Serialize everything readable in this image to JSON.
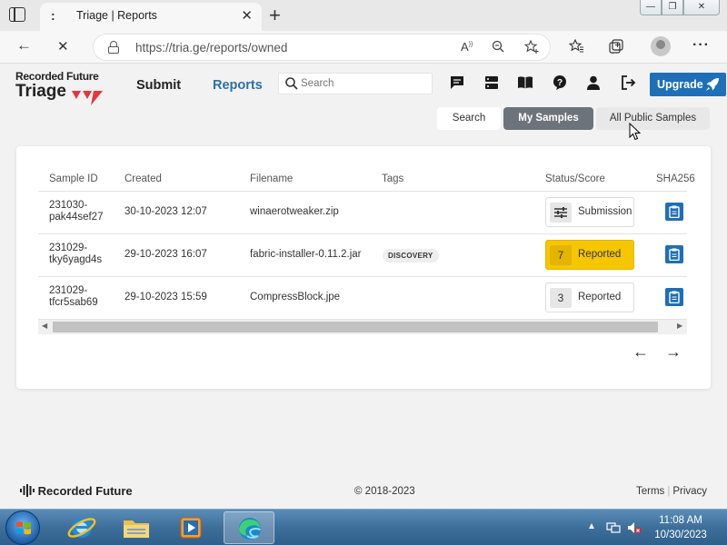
{
  "browser": {
    "tab_title": "Triage | Reports",
    "tab_dots": ":",
    "tab_close": "✕",
    "new_tab": "+",
    "url": "https://tria.ge/reports/owned",
    "window_min": "—",
    "window_max": "❐",
    "window_close": "✕",
    "back": "←",
    "reload_stop": "✕",
    "more": "···"
  },
  "site": {
    "brand_top": "Recorded Future",
    "brand_bottom": "Triage",
    "nav": {
      "submit": "Submit",
      "reports": "Reports"
    },
    "search": {
      "placeholder": "Search",
      "value": ""
    },
    "upgrade_label": "Upgrade",
    "segments": {
      "search": "Search",
      "my_samples": "My Samples",
      "public_samples": "All Public Samples"
    },
    "accent_color": "#1f6fb8",
    "highlight_color": "#f6c600"
  },
  "table": {
    "columns": [
      "Sample ID",
      "Created",
      "Filename",
      "Tags",
      "Status/Score",
      "SHA256"
    ],
    "rows": [
      {
        "id_line1": "231030-",
        "id_line2": "pak44sef27",
        "created": "30-10-2023 12:07",
        "filename": "winaerotweaker.zip",
        "tag": "",
        "score": "",
        "status": "Submission",
        "score_icon": "sliders-icon"
      },
      {
        "id_line1": "231029-",
        "id_line2": "tky6yagd4s",
        "created": "29-10-2023 16:07",
        "filename": "fabric-installer-0.11.2.jar",
        "tag": "DISCOVERY",
        "score": "7",
        "status": "Reported"
      },
      {
        "id_line1": "231029-",
        "id_line2": "tfcr5sab69",
        "created": "29-10-2023 15:59",
        "filename": "CompressBlock.jpe",
        "tag": "",
        "score": "3",
        "status": "Reported"
      }
    ],
    "pager_prev": "←",
    "pager_next": "→"
  },
  "footer": {
    "brand": "Recorded Future",
    "copyright": "© 2018-2023",
    "terms": "Terms",
    "separator": "|",
    "privacy": "Privacy"
  },
  "taskbar": {
    "time": "11:08 AM",
    "date": "10/30/2023"
  }
}
